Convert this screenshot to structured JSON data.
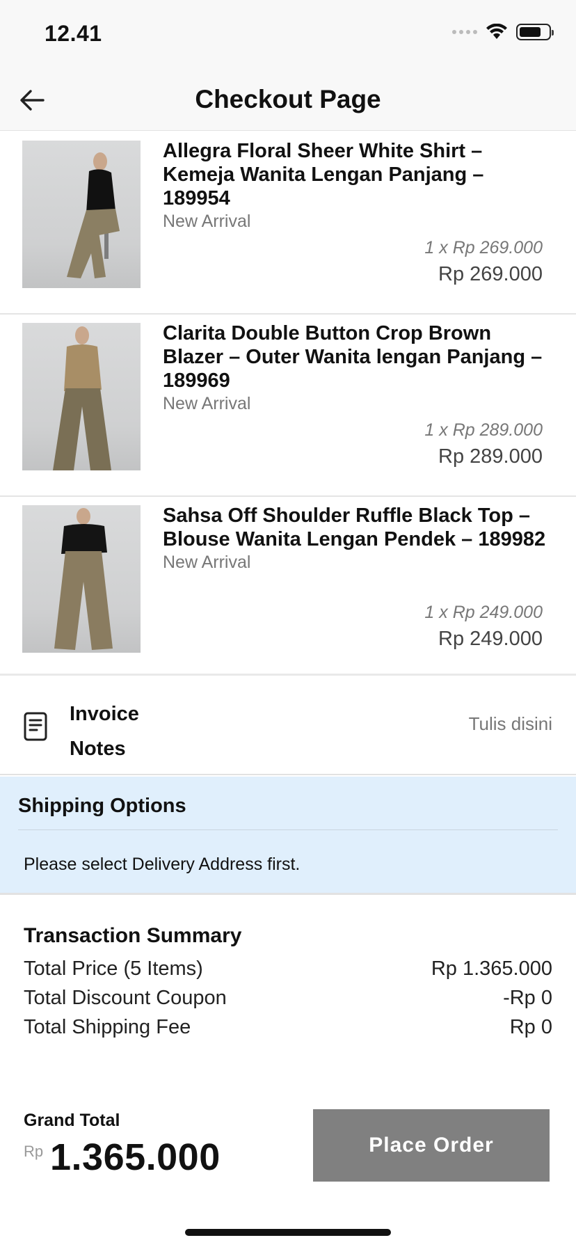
{
  "status_bar": {
    "time": "12.41"
  },
  "header": {
    "title": "Checkout Page"
  },
  "products": [
    {
      "name": "Allegra Floral Sheer White Shirt – Kemeja Wanita Lengan Panjang – 189954",
      "tag": "New Arrival",
      "unit_price": "1 x Rp 269.000",
      "total": "Rp 269.000",
      "top_color": "#111111",
      "bottom_color": "#8b7f63"
    },
    {
      "name": "Clarita Double Button Crop Brown Blazer – Outer Wanita lengan Panjang – 189969",
      "tag": "New Arrival",
      "unit_price": "1 x Rp 289.000",
      "total": "Rp 289.000",
      "top_color": "#a88e66",
      "bottom_color": "#7a6f55"
    },
    {
      "name": "Sahsa Off Shoulder Ruffle Black Top – Blouse Wanita Lengan Pendek – 189982",
      "tag": "New Arrival",
      "unit_price": "1 x Rp 249.000",
      "total": "Rp 249.000",
      "top_color": "#141414",
      "bottom_color": "#8a7c60"
    }
  ],
  "invoice": {
    "label": "Invoice Notes",
    "placeholder": "Tulis disini"
  },
  "shipping": {
    "title": "Shipping Options",
    "message": "Please select Delivery Address first.",
    "background": "#e0effc"
  },
  "summary": {
    "title": "Transaction Summary",
    "rows": [
      {
        "label": "Total Price (5 Items)",
        "value": "Rp 1.365.000"
      },
      {
        "label": "Total Discount Coupon",
        "value": "-Rp 0"
      },
      {
        "label": "Total Shipping Fee",
        "value": "Rp 0"
      }
    ]
  },
  "footer": {
    "grand_label": "Grand Total",
    "currency": "Rp",
    "amount": "1.365.000",
    "button_label": "Place Order",
    "button_color": "#808080"
  }
}
